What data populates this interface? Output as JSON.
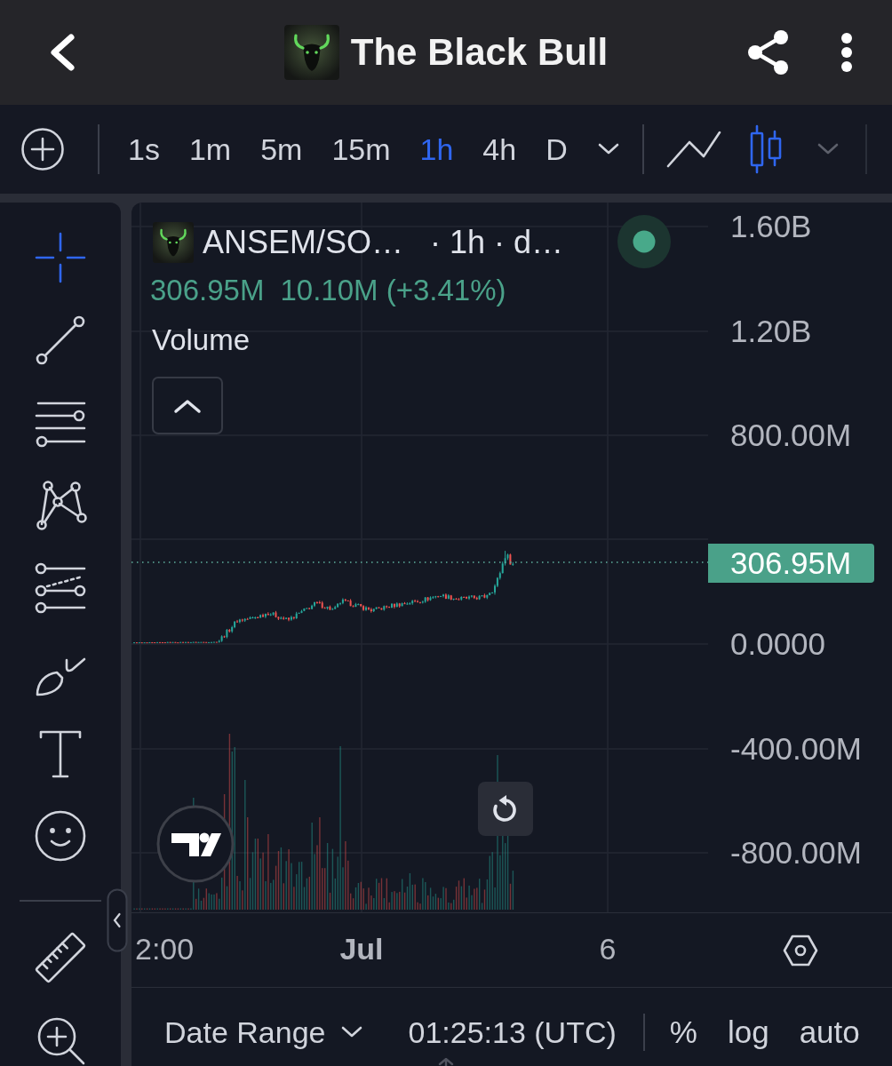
{
  "header": {
    "title": "The Black Bull"
  },
  "toolbar": {
    "intervals": [
      {
        "label": "1s",
        "selected": false
      },
      {
        "label": "1m",
        "selected": false
      },
      {
        "label": "5m",
        "selected": false
      },
      {
        "label": "15m",
        "selected": false
      },
      {
        "label": "1h",
        "selected": true
      },
      {
        "label": "4h",
        "selected": false
      },
      {
        "label": "D",
        "selected": false
      }
    ],
    "chart_types": [
      {
        "kind": "line",
        "selected": false
      },
      {
        "kind": "candles",
        "selected": true
      }
    ]
  },
  "drawing_tools": [
    {
      "kind": "crosshair",
      "selected": true
    },
    {
      "kind": "trend_line",
      "selected": false
    },
    {
      "kind": "parallel_lines",
      "selected": false
    },
    {
      "kind": "pattern",
      "selected": false
    },
    {
      "kind": "fib",
      "selected": false
    },
    {
      "kind": "brush",
      "selected": false
    },
    {
      "kind": "text",
      "selected": false
    },
    {
      "kind": "emoji",
      "selected": false
    }
  ],
  "utility_tools": [
    {
      "kind": "ruler",
      "selected": false
    },
    {
      "kind": "zoom",
      "selected": false
    }
  ],
  "legend": {
    "symbol": "ANSEM/SO…",
    "details": "· 1h · d…",
    "price": "306.95M",
    "change": "10.10M (+3.41%)",
    "indicator": "Volume"
  },
  "price_axis": {
    "upper_labels": [
      "1.60B",
      "1.20B",
      "800.00M"
    ],
    "last_price": "306.95M",
    "lower_labels": [
      "0.0000",
      "-400.00M",
      "-800.00M"
    ]
  },
  "time_axis": {
    "labels": [
      {
        "text": "2:00",
        "kind": "time"
      },
      {
        "text": "Jul",
        "kind": "month"
      },
      {
        "text": "6",
        "kind": "day"
      }
    ]
  },
  "footer": {
    "date_range": "Date Range",
    "time": "01:25:13 (UTC)",
    "scale_options": [
      "%",
      "log",
      "auto"
    ]
  }
}
